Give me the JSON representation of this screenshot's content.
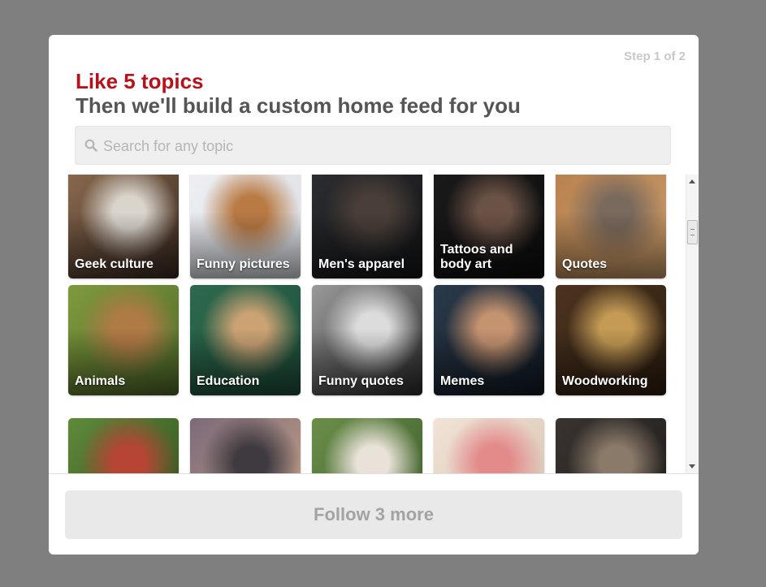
{
  "step_indicator": "Step 1 of 2",
  "heading": {
    "title": "Like 5 topics",
    "subtitle": "Then we'll build a custom home feed for you"
  },
  "search": {
    "placeholder": "Search for any topic",
    "value": "",
    "icon": "search-icon"
  },
  "topics": [
    {
      "label": "Geek culture",
      "colors": [
        "#8b6a4e",
        "#d9d4cc",
        "#3a2a22"
      ]
    },
    {
      "label": "Funny pictures",
      "colors": [
        "#eef0f3",
        "#b97a44",
        "#d8dce2"
      ]
    },
    {
      "label": "Men's apparel",
      "colors": [
        "#2c2d31",
        "#4a3f38",
        "#141517"
      ]
    },
    {
      "label": "Tattoos and\nbody art",
      "colors": [
        "#1a1a1a",
        "#6b5246",
        "#0d0d0d"
      ]
    },
    {
      "label": "Quotes",
      "colors": [
        "#b9824f",
        "#7a6a5d",
        "#c79a6a"
      ]
    },
    {
      "label": "Animals",
      "colors": [
        "#7f9a3d",
        "#b07a46",
        "#4f6a2a"
      ]
    },
    {
      "label": "Education",
      "colors": [
        "#2d6a4e",
        "#caa274",
        "#1e4d3a"
      ]
    },
    {
      "label": "Funny quotes",
      "colors": [
        "#9a9a9a",
        "#dcdcdc",
        "#2a2a2a"
      ]
    },
    {
      "label": "Memes",
      "colors": [
        "#2b3a4a",
        "#c49370",
        "#111a24"
      ]
    },
    {
      "label": "Woodworking",
      "colors": [
        "#4b3420",
        "#c49a55",
        "#2d1d10"
      ]
    },
    {
      "label": "",
      "colors": [
        "#5f8a3a",
        "#b64535",
        "#2f4f1e"
      ]
    },
    {
      "label": "",
      "colors": [
        "#7c6a7a",
        "#3f3a40",
        "#c8a487"
      ]
    },
    {
      "label": "",
      "colors": [
        "#6b8f4a",
        "#e9e2d8",
        "#3b5a2a"
      ]
    },
    {
      "label": "",
      "colors": [
        "#f1e3d6",
        "#e38a8a",
        "#d6c2b0"
      ]
    },
    {
      "label": "",
      "colors": [
        "#3a3430",
        "#8a7a6a",
        "#1c1a18"
      ]
    }
  ],
  "follow_button": "Follow 3 more",
  "scrollbar": {
    "up_icon": "scroll-up-arrow-icon",
    "down_icon": "scroll-down-arrow-icon"
  },
  "colors": {
    "accent_red": "#b5121b",
    "subtitle_gray": "#555555",
    "overlay": "#7f7f7f"
  }
}
